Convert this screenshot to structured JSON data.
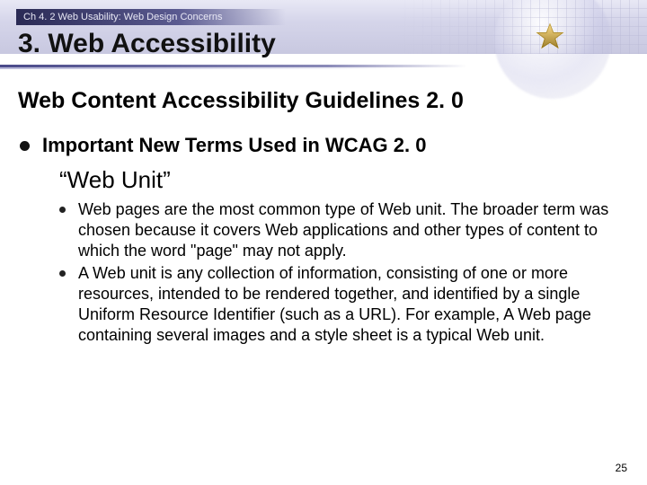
{
  "header": {
    "chapter": "Ch 4. 2 Web Usability: Web Design Concerns",
    "title": "3. Web Accessibility"
  },
  "subtitle": "Web Content Accessibility Guidelines 2. 0",
  "section": {
    "heading": "Important New Terms Used in WCAG 2. 0",
    "definition_term": "“Web Unit”",
    "bullets": [
      "Web pages are the most common type of Web unit. The broader term was chosen because it covers Web applications and other types of content to which the word \"page\" may not apply.",
      "A Web unit is any collection of information, consisting of one or more resources, intended to be rendered together, and identified by a single Uniform Resource Identifier (such as a URL). For example, A Web page containing several images and a style sheet is a typical Web unit."
    ]
  },
  "page_number": "25",
  "colors": {
    "header_gradient_a": "#e8e8f5",
    "header_gradient_b": "#c8c8e0",
    "star_fill": "#f5c545",
    "star_stroke": "#b8901a"
  }
}
